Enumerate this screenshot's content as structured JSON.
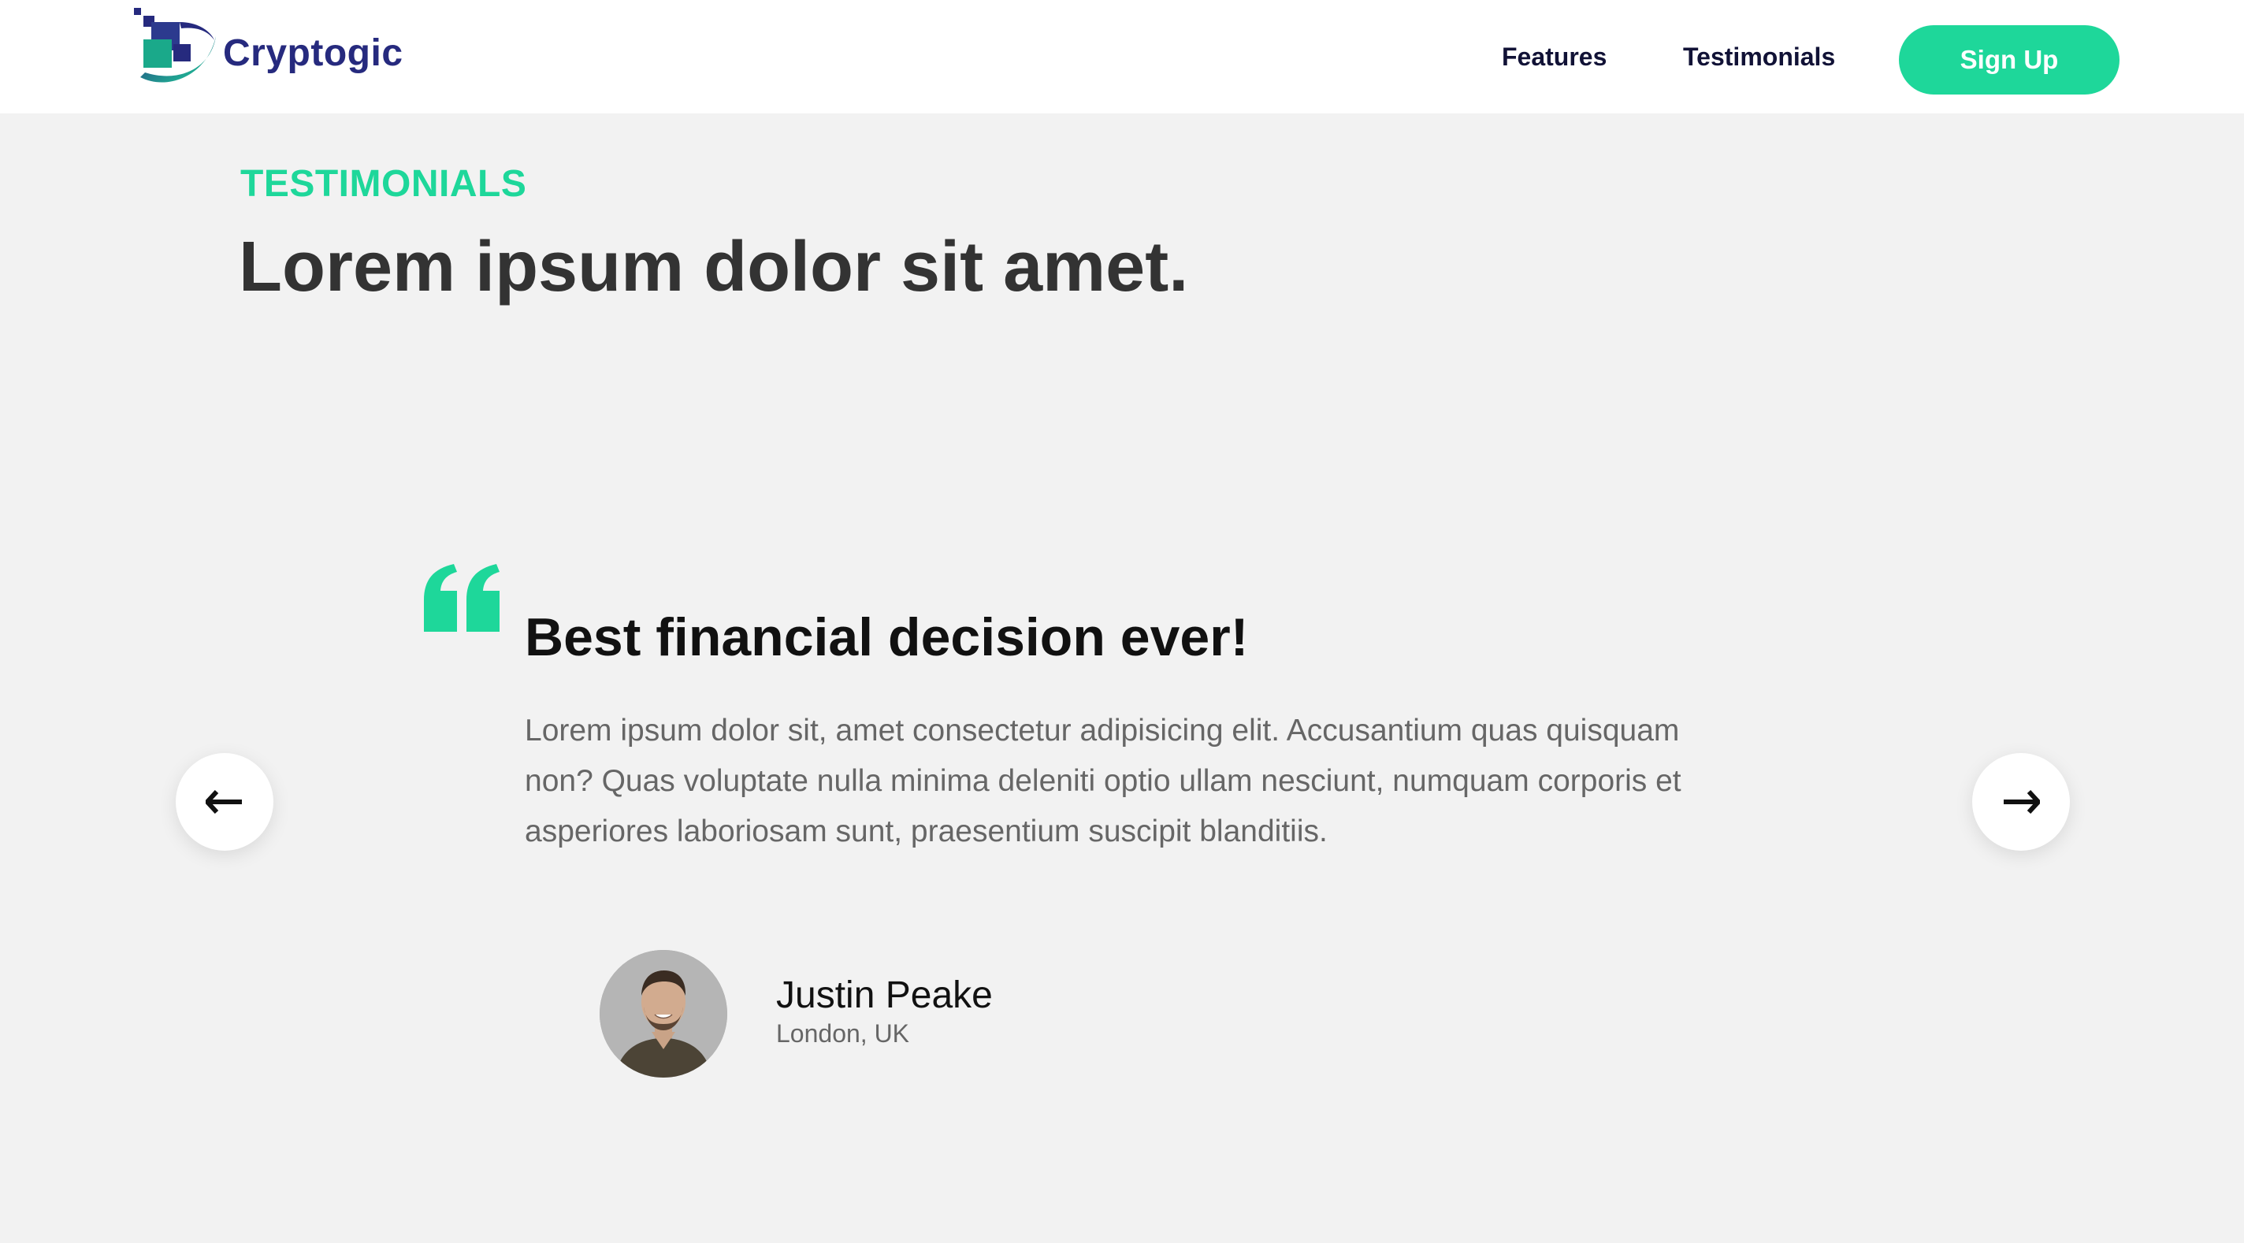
{
  "brand": {
    "name": "Cryptogic",
    "icon": "cryptogic-logo-icon",
    "color": "#262a7e"
  },
  "nav": {
    "links": [
      {
        "label": "Features"
      },
      {
        "label": "Testimonials"
      }
    ],
    "signup_label": "Sign Up"
  },
  "section": {
    "eyebrow": "TESTIMONIALS",
    "heading": "Lorem ipsum dolor sit amet."
  },
  "testimonial": {
    "quote_icon": "quote-icon",
    "title": "Best financial decision ever!",
    "body": "Lorem ipsum dolor sit, amet consectetur adipisicing elit. Accusantium quas quisquam non? Quas voluptate nulla minima deleniti optio ullam nesciunt, numquam corporis et asperiores laboriosam sunt, praesentium suscipit blanditiis.",
    "author_name": "Justin Peake",
    "author_location": "London, UK"
  },
  "carousel": {
    "prev_icon": "arrow-left-icon",
    "next_icon": "arrow-right-icon"
  },
  "colors": {
    "accent": "#1ed79a",
    "nav_text": "#111236",
    "heading": "#333333",
    "body_text": "#666666",
    "background": "#f2f2f2"
  }
}
